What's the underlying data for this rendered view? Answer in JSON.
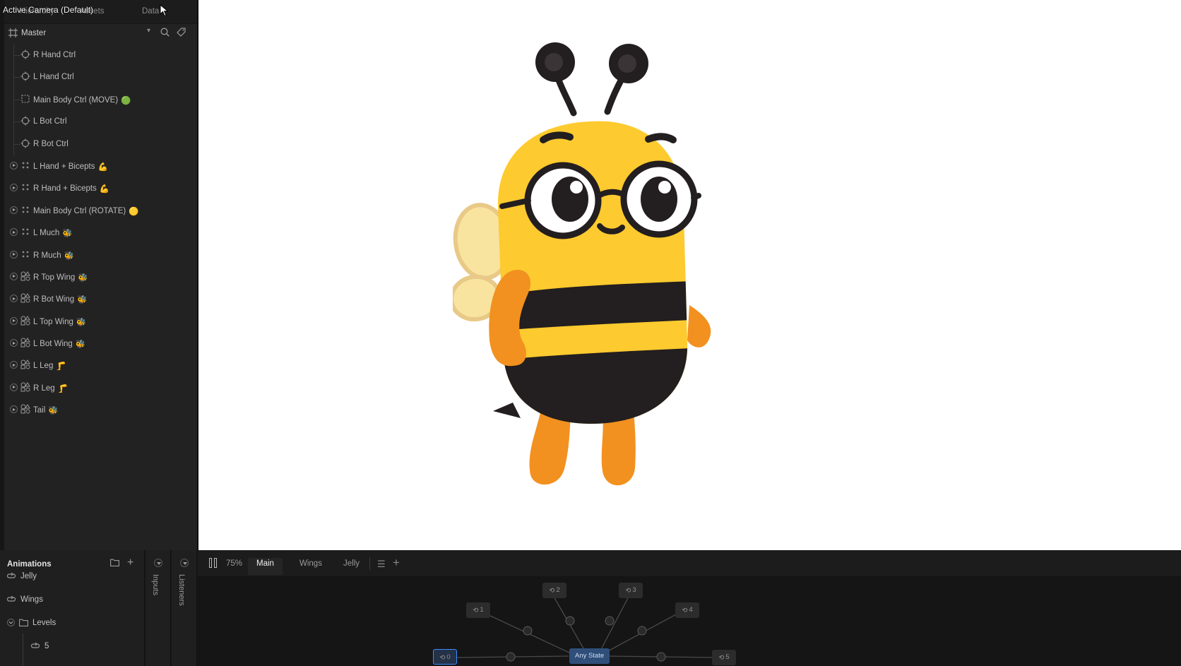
{
  "overlay_title": "Active Camera (Default)",
  "top_tabs": [
    "Hierarchy",
    "Assets",
    "Data"
  ],
  "master": {
    "label": "Master",
    "icons": [
      "artboard-icon",
      "search-icon",
      "tag-icon"
    ]
  },
  "hierarchy": [
    {
      "label": "R Hand Ctrl",
      "icon": "target-icon",
      "expandable": false,
      "emoji": ""
    },
    {
      "label": "L Hand Ctrl",
      "icon": "target-icon",
      "expandable": false,
      "emoji": ""
    },
    {
      "label": "Main Body Ctrl (MOVE)",
      "icon": "artboard-icon",
      "expandable": false,
      "emoji": "🟢"
    },
    {
      "label": "L Bot Ctrl",
      "icon": "target-icon",
      "expandable": false,
      "emoji": ""
    },
    {
      "label": "R Bot Ctrl",
      "icon": "target-icon",
      "expandable": false,
      "emoji": ""
    },
    {
      "label": "L Hand + Bicepts",
      "icon": "group-icon",
      "expandable": true,
      "emoji": "💪"
    },
    {
      "label": "R Hand + Bicepts",
      "icon": "group-icon",
      "expandable": true,
      "emoji": "💪"
    },
    {
      "label": "Main Body Ctrl (ROTATE)",
      "icon": "group-icon",
      "expandable": true,
      "emoji": "🟡"
    },
    {
      "label": "L Much",
      "icon": "group-icon",
      "expandable": true,
      "emoji": "🐝"
    },
    {
      "label": "R Much",
      "icon": "group-icon",
      "expandable": true,
      "emoji": "🐝"
    },
    {
      "label": "R Top Wing",
      "icon": "shapes-icon",
      "expandable": true,
      "emoji": "🐝"
    },
    {
      "label": "R Bot Wing",
      "icon": "shapes-icon",
      "expandable": true,
      "emoji": "🐝"
    },
    {
      "label": "L Top Wing",
      "icon": "shapes-icon",
      "expandable": true,
      "emoji": "🐝"
    },
    {
      "label": "L Bot Wing",
      "icon": "shapes-icon",
      "expandable": true,
      "emoji": "🐝"
    },
    {
      "label": "L Leg",
      "icon": "shapes-icon",
      "expandable": true,
      "emoji": "🦵"
    },
    {
      "label": "R Leg",
      "icon": "shapes-icon",
      "expandable": true,
      "emoji": "🦵"
    },
    {
      "label": "Tail",
      "icon": "shapes-icon",
      "expandable": true,
      "emoji": "🐝"
    }
  ],
  "animations": {
    "title": "Animations",
    "items": [
      {
        "label": "Jelly",
        "icon": "loop-icon"
      },
      {
        "label": "Wings",
        "icon": "loop-icon"
      },
      {
        "label": "Levels",
        "icon": "folder-icon"
      },
      {
        "label": "5",
        "icon": "loop-icon"
      }
    ]
  },
  "side_strips": {
    "inputs": "Inputs",
    "listeners": "Listeners"
  },
  "state_machine": {
    "zoom": "75%",
    "tabs": [
      "Main",
      "Wings",
      "Jelly"
    ],
    "active_tab": "Main",
    "nodes": [
      {
        "label": "1"
      },
      {
        "label": "2"
      },
      {
        "label": "3"
      },
      {
        "label": "4"
      },
      {
        "label": "0"
      },
      {
        "label": "Any State"
      },
      {
        "label": "5"
      }
    ]
  },
  "colors": {
    "panel_bg": "#222222",
    "canvas_bg": "#ffffff",
    "accent_blue": "#3d8bff",
    "bee_yellow": "#fdca2f",
    "bee_orange": "#f2911f",
    "bee_dark": "#231e1f"
  }
}
